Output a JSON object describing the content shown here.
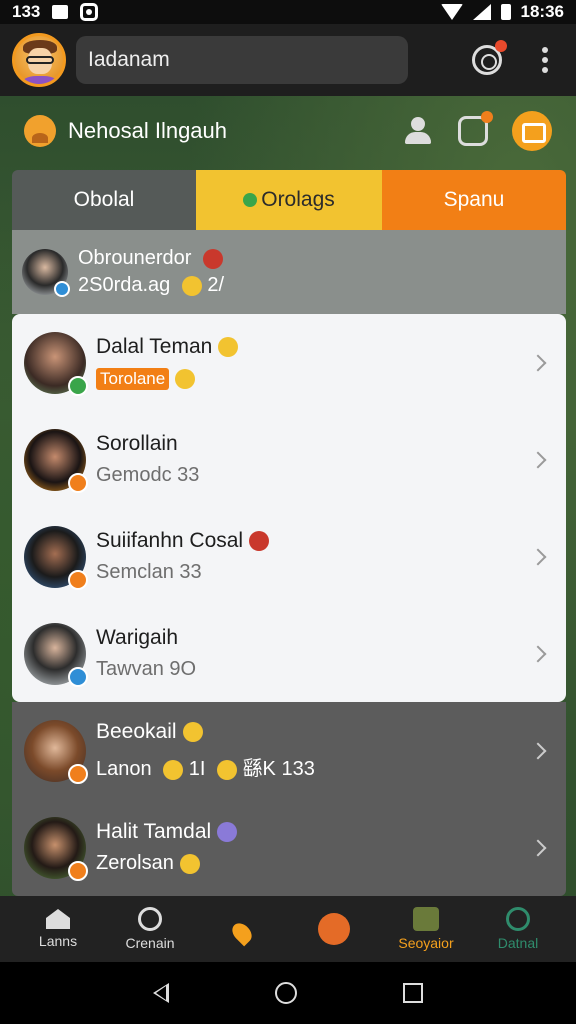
{
  "status_bar": {
    "left_text": "133",
    "time": "18:36"
  },
  "search": {
    "value": "Iadanam"
  },
  "section": {
    "title": "Nehosal Ilngauh"
  },
  "tabs": [
    {
      "label": "Obolal"
    },
    {
      "label": "Orolags"
    },
    {
      "label": "Spanu"
    }
  ],
  "pinned": {
    "name": "Obrounerdor",
    "sub": "2S0rda.ag",
    "sub_extra": "2/"
  },
  "contacts": [
    {
      "name": "Dalal Teman",
      "chip": "Torolane",
      "sub": ""
    },
    {
      "name": "Sorollain",
      "sub": "Gemodc 33"
    },
    {
      "name": "Suiifanhn Cosal",
      "sub": "Semclan 33"
    },
    {
      "name": "Warigaih",
      "sub": "Tawvan 9O"
    }
  ],
  "contacts_dark": [
    {
      "name": "Beeokail",
      "sub": "Lanon",
      "sub_extra": "1I",
      "sub_extra2": "繇K  133"
    },
    {
      "name": "Halit Tamdal",
      "sub": "Zerolsan"
    }
  ],
  "bottom_nav": [
    {
      "label": "Lanns"
    },
    {
      "label": "Crenain"
    },
    {
      "label": ""
    },
    {
      "label": ""
    },
    {
      "label": "Seoyaior"
    },
    {
      "label": "Datnal"
    }
  ],
  "colors": {
    "accent_orange": "#f27f15",
    "accent_yellow": "#f2c330",
    "online_green": "#3aa54a"
  }
}
